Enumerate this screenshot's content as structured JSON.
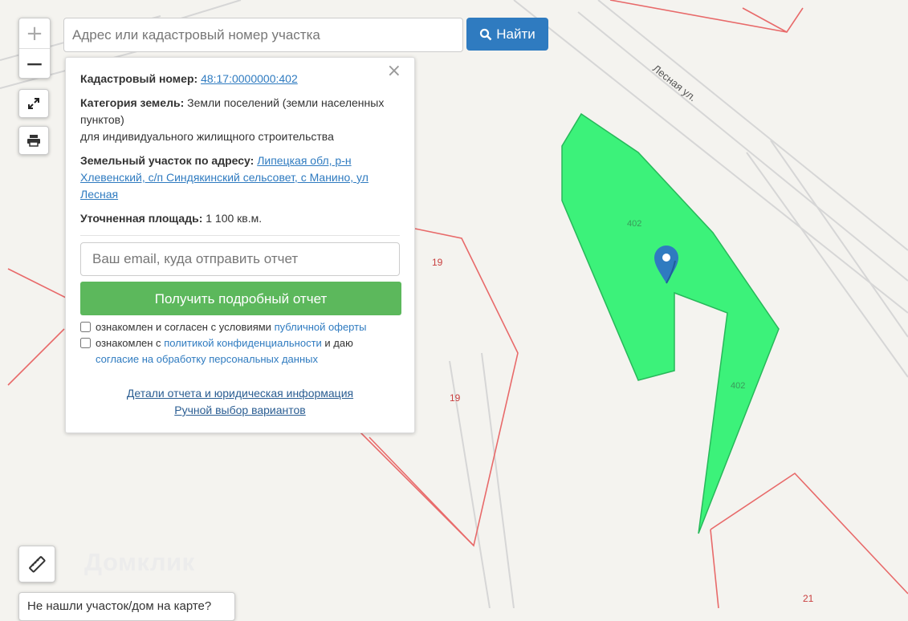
{
  "map": {
    "colors": {
      "parcel_fill": "#3cf27a",
      "parcel_stroke": "#27b85a",
      "boundary": "#e86a6a",
      "road": "#d9d9d9",
      "background": "#f4f3ef"
    },
    "street_label": "Лесная ул.",
    "parcel_labels": [
      "402",
      "402"
    ],
    "boundary_labels": [
      "19",
      "19",
      "21"
    ],
    "watermark": "Домклик"
  },
  "controls": {
    "zoom_in": "+",
    "zoom_out": "−",
    "fullscreen_icon": "expand-icon",
    "print_icon": "printer-icon",
    "ruler_icon": "ruler-icon"
  },
  "search": {
    "placeholder": "Адрес или кадастровый номер участка",
    "button_label": "Найти",
    "button_icon": "search-icon"
  },
  "panel": {
    "close": "×",
    "cadastral_label": "Кадастровый номер:",
    "cadastral_value": "48:17:0000000:402",
    "category_label": "Категория земель:",
    "category_value": "Земли поселений (земли населенных пунктов)",
    "category_use": "для индивидуального жилищного строительства",
    "address_label": "Земельный участок по адресу:",
    "address_value": "Липецкая обл, р-н Хлевенский, с/п Синдякинский сельсовет, с Манино, ул Лесная",
    "area_label": "Уточненная площадь:",
    "area_value": "1 100 кв.м.",
    "email_placeholder": "Ваш email, куда отправить отчет",
    "get_report": "Получить подробный отчет",
    "consent1_text": "ознакомлен и согласен с условиями",
    "consent1_link": "публичной оферты",
    "consent2_text_a": "ознакомлен с",
    "consent2_link_a": "политикой конфиденциальности",
    "consent2_text_b": "и даю",
    "consent2_link_b": "согласие на обработку персональных данных",
    "details_link": "Детали отчета и юридическая информация",
    "manual_link": "Ручной выбор вариантов"
  },
  "not_found": "Не нашли участок/дом на карте?"
}
